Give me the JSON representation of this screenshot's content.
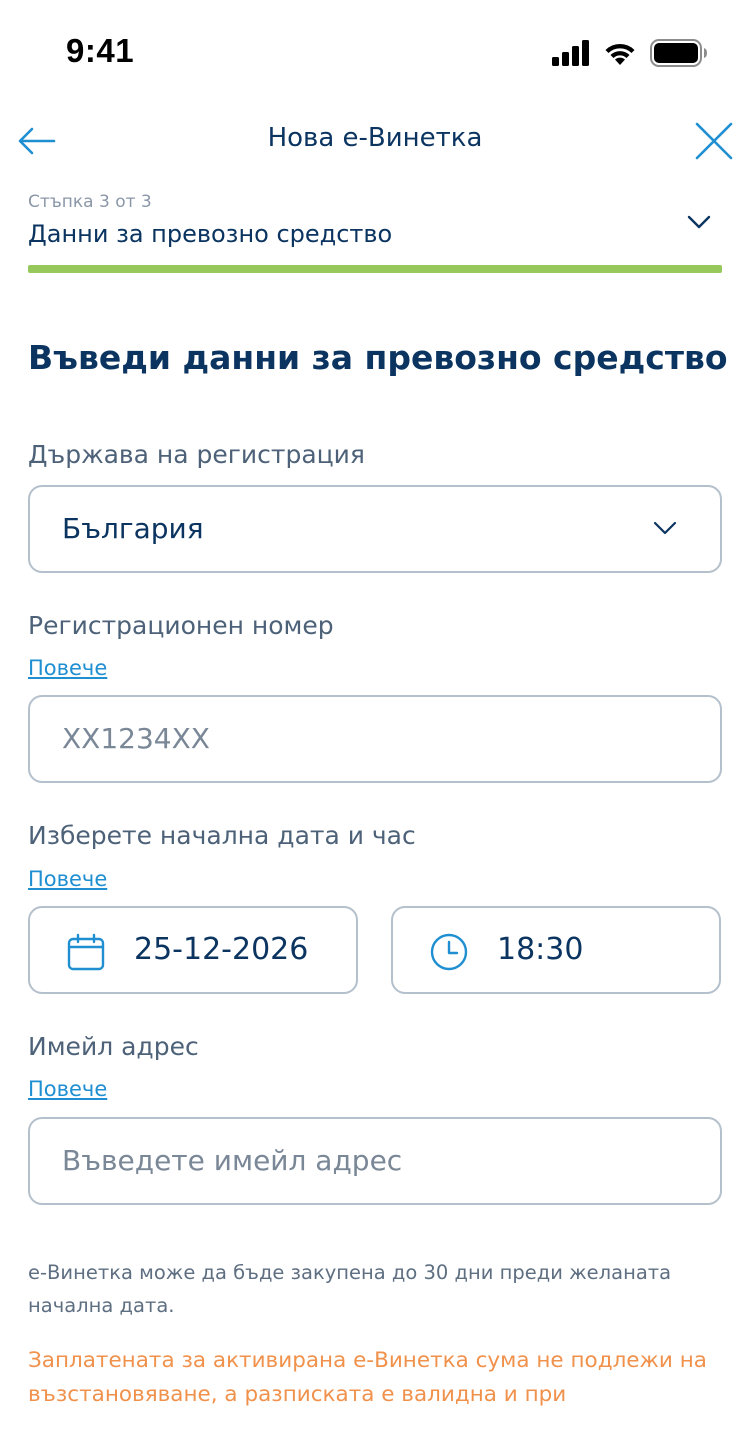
{
  "status_bar": {
    "time": "9:41",
    "icons": [
      "cellular-signal-icon",
      "wifi-icon",
      "battery-icon"
    ]
  },
  "nav": {
    "title": "Нова е-Винетка",
    "back_icon": "arrow-left-icon",
    "close_icon": "close-icon"
  },
  "step": {
    "caption": "Стъпка 3 от 3",
    "title": "Данни за превозно средство",
    "progress": 1.0
  },
  "form": {
    "heading": "Въведи данни за превозно средство",
    "country": {
      "label": "Държава на регистрация",
      "value": "България"
    },
    "plate": {
      "label": "Регистрационен номер",
      "more": "Повече",
      "placeholder": "XX1234XX"
    },
    "start": {
      "label": "Изберете начална дата и час",
      "more": "Повече",
      "date": "25-12-2026",
      "time": "18:30"
    },
    "email": {
      "label": "Имейл адрес",
      "more": "Повече",
      "placeholder": "Въведете имейл адрес"
    }
  },
  "notes": {
    "info": "е-Винетка може да бъде закупена до 30 дни преди желаната начална дата.",
    "warning": "Заплатената за активирана е-Винетка сума не подлежи на възстановяване, а разписката е валидна и при"
  },
  "colors": {
    "primary": "#0b3560",
    "accent": "#1f8fd1",
    "progress": "#97c85b",
    "warning": "#f0914c",
    "border": "#b4c0cc"
  }
}
